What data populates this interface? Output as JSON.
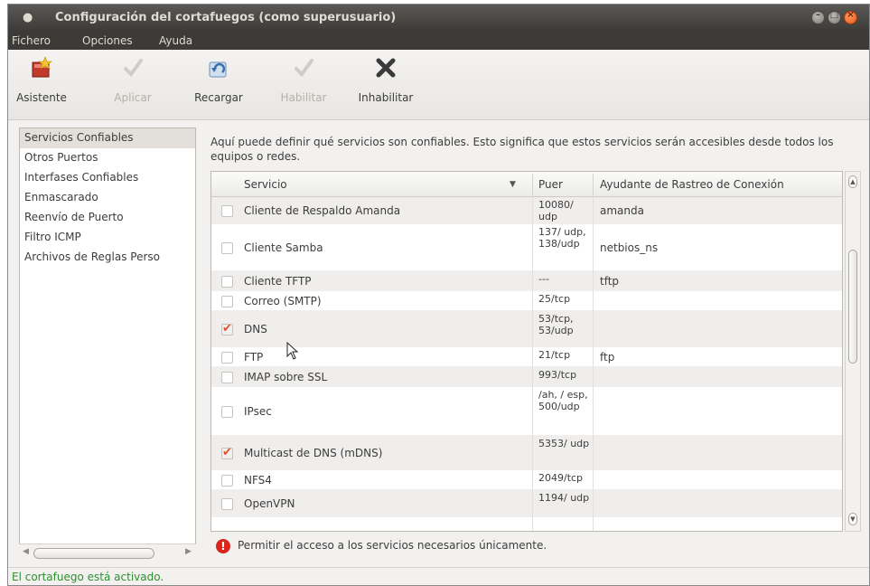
{
  "window": {
    "title": "Configuración del cortafuegos (como superusuario)"
  },
  "menubar": {
    "items": [
      "Fichero",
      "Opciones",
      "Ayuda"
    ]
  },
  "toolbar": {
    "buttons": [
      {
        "label": "Asistente",
        "icon": "wizard-icon",
        "enabled": true
      },
      {
        "label": "Aplicar",
        "icon": "apply-check-icon",
        "enabled": false
      },
      {
        "label": "Recargar",
        "icon": "reload-icon",
        "enabled": true
      },
      {
        "label": "Habilitar",
        "icon": "enable-check-icon",
        "enabled": false
      },
      {
        "label": "Inhabilitar",
        "icon": "disable-x-icon",
        "enabled": true
      }
    ]
  },
  "sidebar": {
    "items": [
      "Servicios Confiables",
      "Otros Puertos",
      "Interfases Confiables",
      "Enmascarado",
      "Reenvío de Puerto",
      "Filtro ICMP",
      "Archivos de Reglas Perso"
    ],
    "selected": "Servicios Confiables"
  },
  "main": {
    "description": "Aquí puede definir qué servicios son confiables. Esto significa que estos servicios serán accesibles desde todos los equipos o redes.",
    "columns": [
      "Servicio",
      "Puer",
      "Ayudante de Rastreo de Conexión"
    ],
    "rows": [
      {
        "service": "Cliente de Respaldo Amanda",
        "port": "10080/ udp",
        "helper": "amanda",
        "checked": false
      },
      {
        "service": "Cliente Samba",
        "port": "137/ udp, 138/udp",
        "helper": "netbios_ns",
        "checked": false
      },
      {
        "service": "Cliente TFTP",
        "port": "---",
        "helper": "tftp",
        "checked": false
      },
      {
        "service": "Correo (SMTP)",
        "port": "25/tcp",
        "helper": "",
        "checked": false
      },
      {
        "service": "DNS",
        "port": "53/tcp, 53/udp",
        "helper": "",
        "checked": true
      },
      {
        "service": "FTP",
        "port": "21/tcp",
        "helper": "ftp",
        "checked": false
      },
      {
        "service": "IMAP sobre SSL",
        "port": "993/tcp",
        "helper": "",
        "checked": false
      },
      {
        "service": "IPsec",
        "port": "/ah, / esp, 500/udp",
        "helper": "",
        "checked": false
      },
      {
        "service": "Multicast de DNS (mDNS)",
        "port": "5353/ udp",
        "helper": "",
        "checked": true
      },
      {
        "service": "NFS4",
        "port": "2049/tcp",
        "helper": "",
        "checked": false
      },
      {
        "service": "OpenVPN",
        "port": "1194/ udp",
        "helper": "",
        "checked": false
      }
    ],
    "warning": "Permitir el acceso a los servicios necesarios únicamente."
  },
  "status": {
    "text": "El cortafuego está activado.",
    "color": "#2f8f2f"
  },
  "colors": {
    "accent": "#e0502a",
    "titlebar": "#3c3b37",
    "warning": "#d9261c"
  }
}
